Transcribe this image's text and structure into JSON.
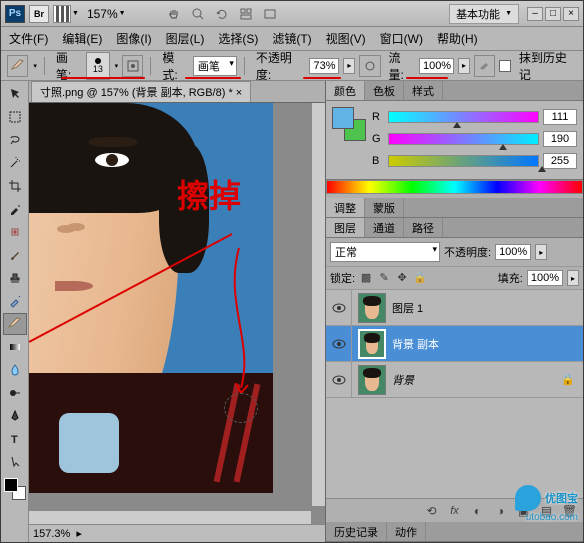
{
  "titlebar": {
    "zoom": "157%",
    "workspace_label": "基本功能"
  },
  "menu": [
    "文件(F)",
    "编辑(E)",
    "图像(I)",
    "图层(L)",
    "选择(S)",
    "滤镜(T)",
    "视图(V)",
    "窗口(W)",
    "帮助(H)"
  ],
  "options": {
    "brush_label": "画笔:",
    "brush_size": "13",
    "mode_label": "模式:",
    "mode_value": "画笔",
    "opacity_label": "不透明度:",
    "opacity_value": "73%",
    "flow_label": "流量:",
    "flow_value": "100%",
    "erase_history": "抹到历史记"
  },
  "doc": {
    "tab": "寸照.png @ 157% (背景 副本, RGB/8) *",
    "status_zoom": "157.3%"
  },
  "annotation": {
    "text": "擦掉"
  },
  "color_panel": {
    "tabs": [
      "颜色",
      "色板",
      "样式"
    ],
    "channels": [
      {
        "label": "R",
        "value": "111",
        "cls": "slider-r",
        "pos": 43
      },
      {
        "label": "G",
        "value": "190",
        "cls": "slider-g",
        "pos": 74
      },
      {
        "label": "B",
        "value": "255",
        "cls": "slider-b",
        "pos": 100
      }
    ]
  },
  "adjust_panel": {
    "tabs": [
      "调整",
      "蒙版"
    ]
  },
  "layers_panel": {
    "tabs": [
      "图层",
      "通道",
      "路径"
    ],
    "blend": "正常",
    "opacity_label": "不透明度:",
    "opacity": "100%",
    "lock_label": "锁定:",
    "fill_label": "填充:",
    "fill": "100%",
    "layers": [
      {
        "name": "图层 1",
        "sel": false,
        "italic": false
      },
      {
        "name": "背景 副本",
        "sel": true,
        "italic": false
      },
      {
        "name": "背景",
        "sel": false,
        "italic": true
      }
    ],
    "bottom_tabs": [
      "历史记录",
      "动作"
    ]
  },
  "watermark": {
    "brand": "优图宝",
    "url": "utobao.com"
  }
}
